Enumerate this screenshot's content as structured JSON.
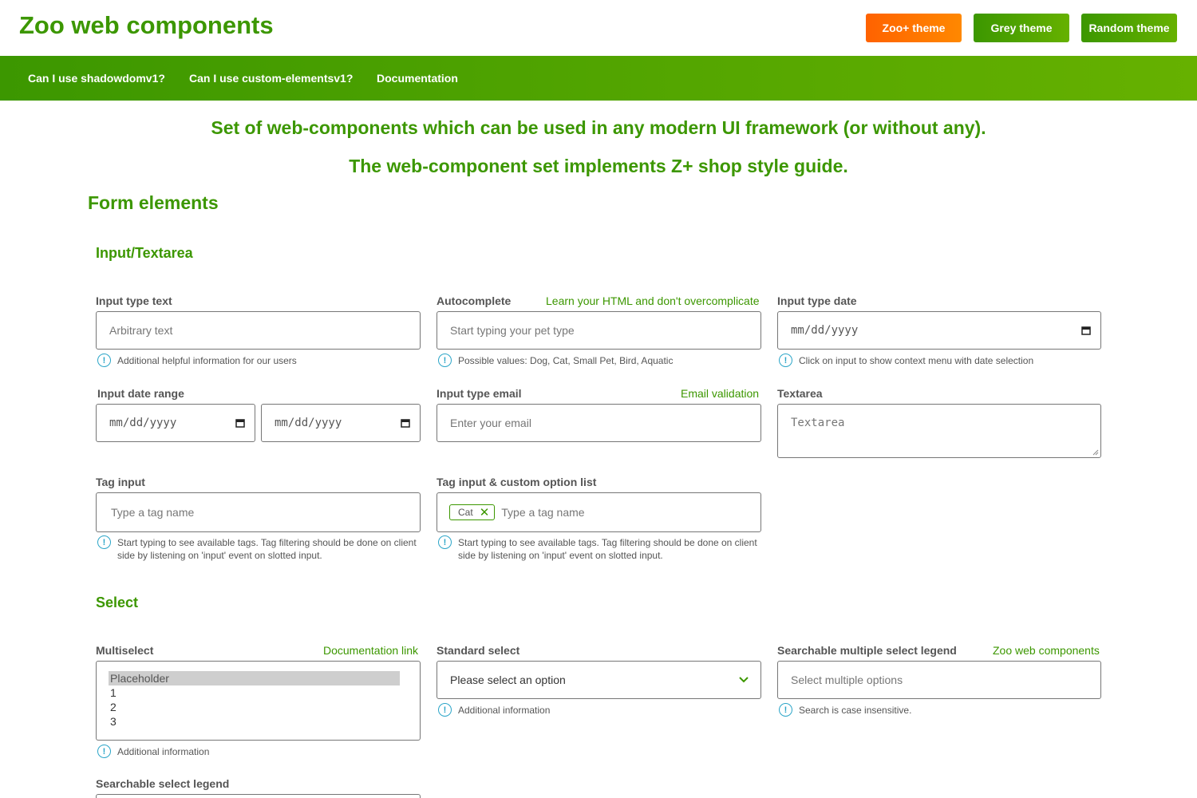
{
  "header": {
    "title": "Zoo web components",
    "themes": [
      {
        "label": "Zoo+ theme",
        "color": "#ff6200"
      },
      {
        "label": "Grey theme",
        "color": "#3c9700"
      },
      {
        "label": "Random theme",
        "color": "#3c9700"
      }
    ]
  },
  "nav": {
    "links": [
      "Can I use shadowdomv1?",
      "Can I use custom-elementsv1?",
      "Documentation"
    ]
  },
  "intro": {
    "line1": "Set of web-components which can be used in any modern UI framework (or without any).",
    "line2": "The web-component set implements Z+ shop style guide."
  },
  "form_section": {
    "title": "Form elements",
    "input_group": {
      "title": "Input/Textarea",
      "text_input": {
        "label": "Input type text",
        "placeholder": "Arbitrary text",
        "info": "Additional helpful information for our users"
      },
      "autocomplete": {
        "label": "Autocomplete",
        "link": "Learn your HTML and don't overcomplicate",
        "placeholder": "Start typing your pet type",
        "info": "Possible values: Dog, Cat, Small Pet, Bird, Aquatic"
      },
      "date_input": {
        "label": "Input type date",
        "value": "mm/dd/yyyy",
        "info": "Click on input to show context menu with date selection"
      },
      "date_range": {
        "label": "Input date range",
        "from": "mm/dd/yyyy",
        "to": "mm/dd/yyyy"
      },
      "email_input": {
        "label": "Input type email",
        "link": "Email validation",
        "placeholder": "Enter your email"
      },
      "textarea": {
        "label": "Textarea",
        "placeholder": "Textarea"
      },
      "tag_input": {
        "label": "Tag input",
        "placeholder": "Type a tag name",
        "info_line1": "Start typing to see available tags. Tag filtering should be done on client",
        "info_line2": "side by listening on 'input' event on slotted input."
      },
      "tag_custom": {
        "label": "Tag input & custom option list",
        "tag": "Cat",
        "placeholder": "Type a tag name",
        "info_line1": "Start typing to see available tags. Tag filtering should be done on client",
        "info_line2": "side by listening on 'input' event on slotted input."
      }
    },
    "select_group": {
      "title": "Select",
      "multiselect": {
        "label": "Multiselect",
        "link": "Documentation link",
        "options": [
          "Placeholder",
          "1",
          "2",
          "3"
        ],
        "info": "Additional information"
      },
      "standard_select": {
        "label": "Standard select",
        "value": "Please select an option",
        "info": "Additional information"
      },
      "searchable_multi": {
        "label": "Searchable multiple select legend",
        "link": "Zoo web components",
        "placeholder": "Select multiple options",
        "info": "Search is case insensitive."
      },
      "searchable_select": {
        "label": "Searchable select legend"
      }
    }
  },
  "colors": {
    "brand": "#3c9700",
    "brand_light": "#66b100",
    "accent": "#ff6200",
    "info": "#2ba5c8"
  }
}
